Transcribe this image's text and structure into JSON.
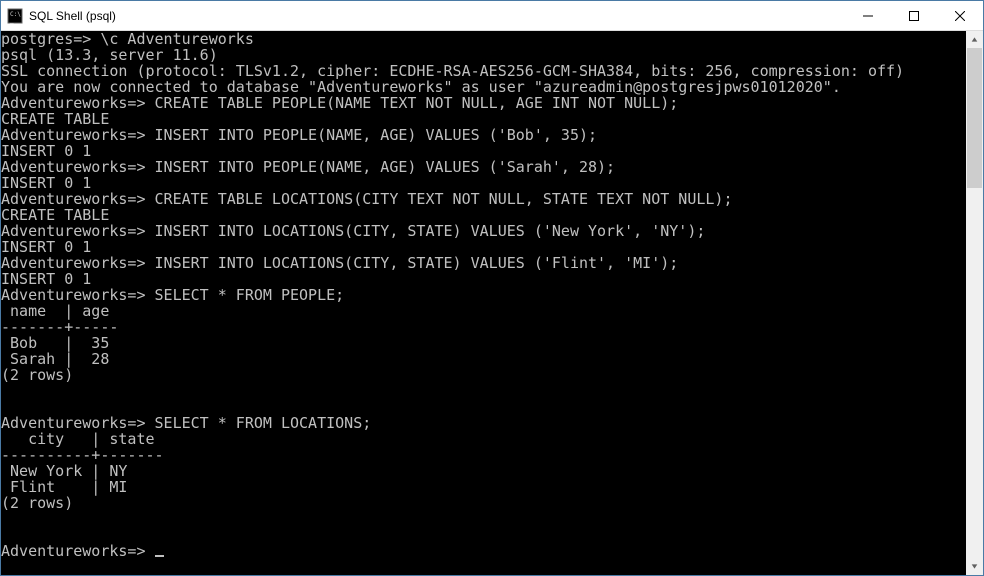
{
  "window": {
    "title": "SQL Shell (psql)"
  },
  "terminal": {
    "lines": [
      "postgres=> \\c Adventureworks",
      "psql (13.3, server 11.6)",
      "SSL connection (protocol: TLSv1.2, cipher: ECDHE-RSA-AES256-GCM-SHA384, bits: 256, compression: off)",
      "You are now connected to database \"Adventureworks\" as user \"azureadmin@postgresjpws01012020\".",
      "Adventureworks=> CREATE TABLE PEOPLE(NAME TEXT NOT NULL, AGE INT NOT NULL);",
      "CREATE TABLE",
      "Adventureworks=> INSERT INTO PEOPLE(NAME, AGE) VALUES ('Bob', 35);",
      "INSERT 0 1",
      "Adventureworks=> INSERT INTO PEOPLE(NAME, AGE) VALUES ('Sarah', 28);",
      "INSERT 0 1",
      "Adventureworks=> CREATE TABLE LOCATIONS(CITY TEXT NOT NULL, STATE TEXT NOT NULL);",
      "CREATE TABLE",
      "Adventureworks=> INSERT INTO LOCATIONS(CITY, STATE) VALUES ('New York', 'NY');",
      "INSERT 0 1",
      "Adventureworks=> INSERT INTO LOCATIONS(CITY, STATE) VALUES ('Flint', 'MI');",
      "INSERT 0 1",
      "Adventureworks=> SELECT * FROM PEOPLE;",
      " name  | age",
      "-------+-----",
      " Bob   |  35",
      " Sarah |  28",
      "(2 rows)",
      "",
      "",
      "Adventureworks=> SELECT * FROM LOCATIONS;",
      "   city   | state",
      "----------+-------",
      " New York | NY",
      " Flint    | MI",
      "(2 rows)",
      "",
      "",
      "Adventureworks=>"
    ]
  }
}
